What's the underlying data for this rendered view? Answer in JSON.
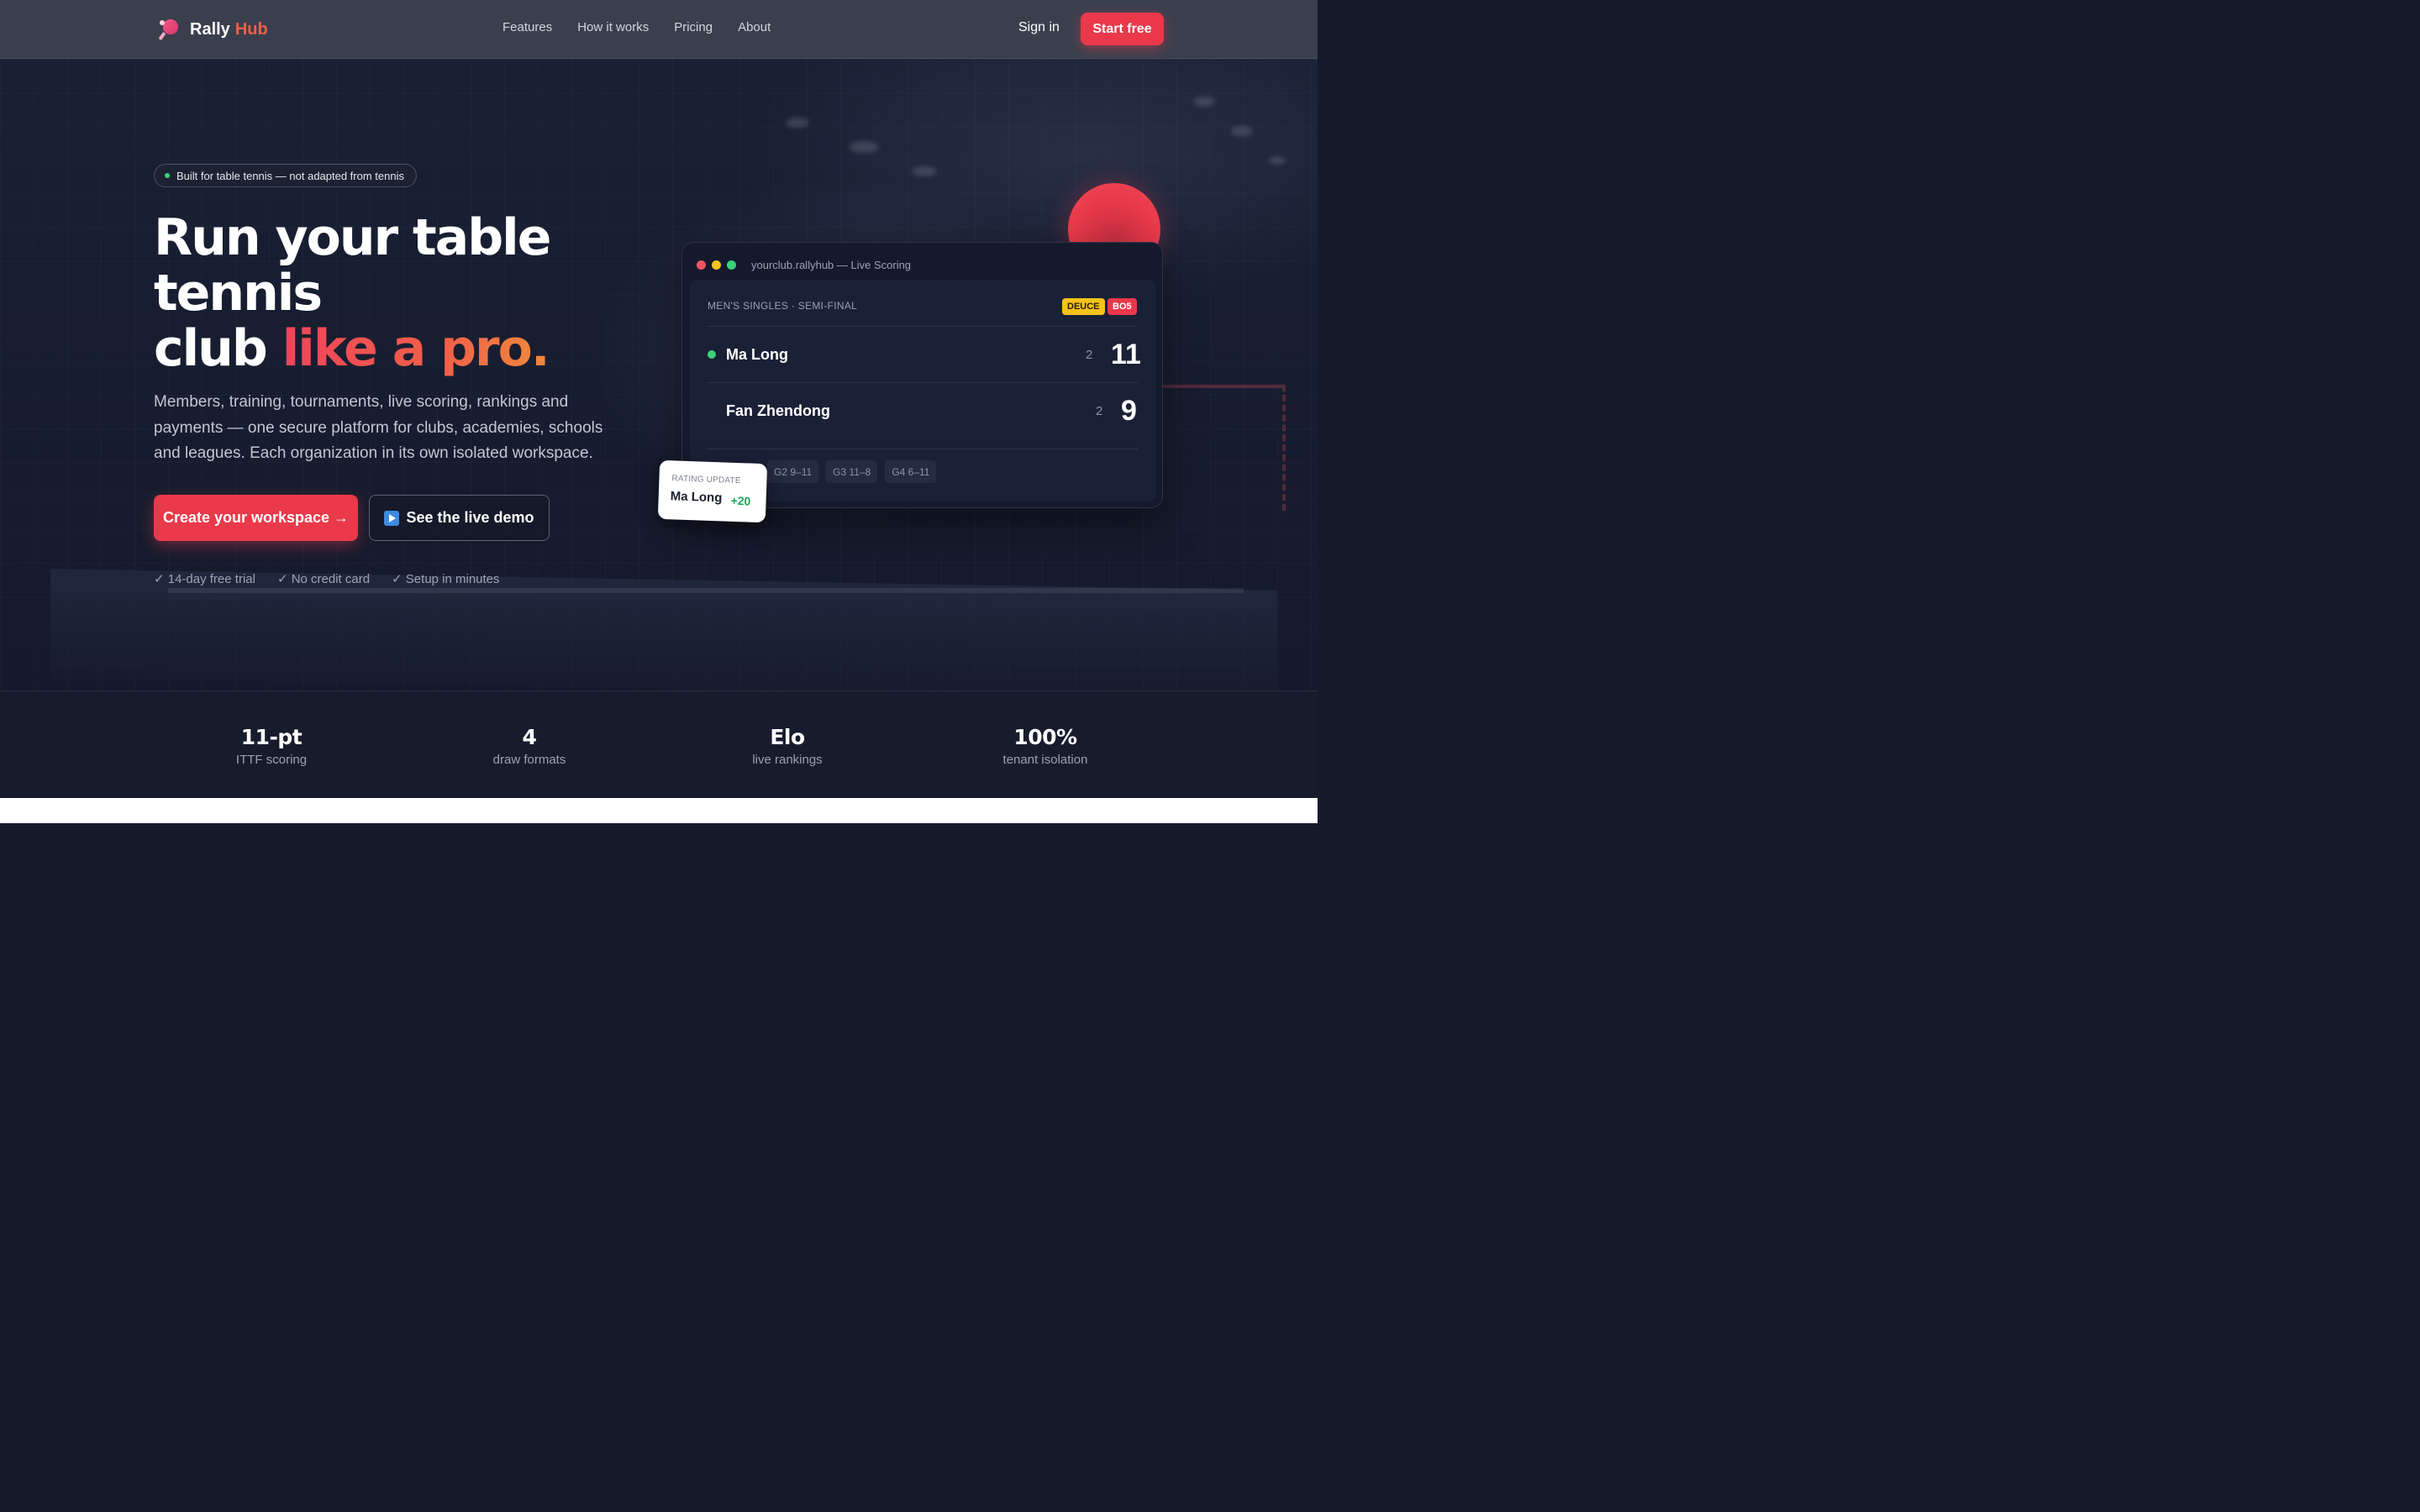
{
  "brand": {
    "name_1": "Rally",
    "name_2": "Hub"
  },
  "nav": {
    "items": [
      "Features",
      "How it works",
      "Pricing",
      "About"
    ]
  },
  "header": {
    "signin": "Sign in",
    "start": "Start free"
  },
  "hero": {
    "pill": "Built for table tennis — not adapted from tennis",
    "headline_line1": "Run your table",
    "headline_line2": "tennis",
    "headline_line3_plain": "club ",
    "headline_line3_accent": "like a pro.",
    "subtext": "Members, training, tournaments, live scoring, rankings and payments — one secure platform for clubs, academies, schools and leagues. Each organization in its own isolated workspace.",
    "cta_primary": "Create your workspace →",
    "cta_secondary": "See the live demo",
    "checks": [
      "✓ 14-day free trial",
      "✓ No credit card",
      "✓ Setup in minutes"
    ]
  },
  "scoring": {
    "url": "yourclub.rallyhub — Live Scoring",
    "match_label": "MEN'S SINGLES · SEMI-FINAL",
    "badge_deuce": "DEUCE",
    "badge_bo5": "BO5",
    "players": [
      {
        "name": "Ma Long",
        "games": "2",
        "points": "11",
        "serving": true
      },
      {
        "name": "Fan Zhendong",
        "games": "2",
        "points": "9",
        "serving": false
      }
    ],
    "chips": [
      "G2 9–11",
      "G3 11–8",
      "G4 6–11"
    ]
  },
  "rating": {
    "label": "RATING UPDATE",
    "name": "Ma Long",
    "delta": "+20"
  },
  "stats": [
    {
      "value": "11-pt",
      "label": "ITTF scoring"
    },
    {
      "value": "4",
      "label": "draw formats"
    },
    {
      "value": "Elo",
      "label": "live rankings"
    },
    {
      "value": "100%",
      "label": "tenant isolation"
    }
  ],
  "colors": {
    "accent": "#e9394a",
    "orange": "#f0604a",
    "live": "#3ad17a",
    "deuce": "#f3c21b"
  }
}
